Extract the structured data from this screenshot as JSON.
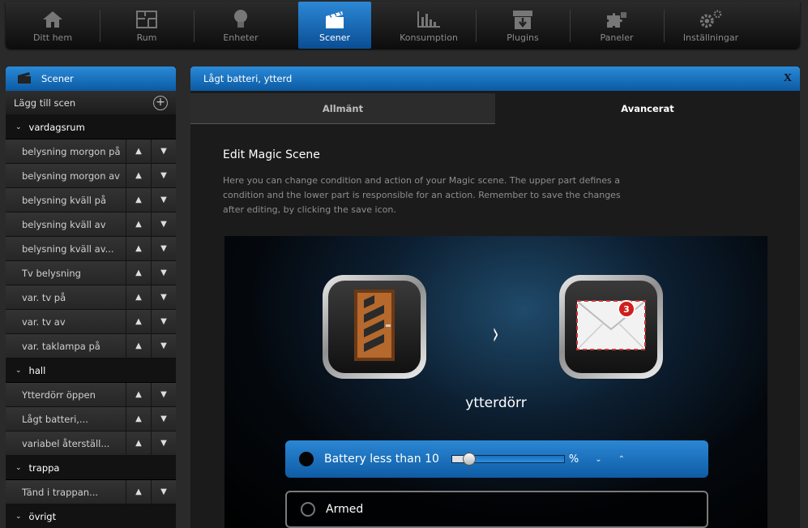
{
  "nav": {
    "items": [
      {
        "label": "Ditt hem",
        "icon": "house-icon"
      },
      {
        "label": "Rum",
        "icon": "floorplan-icon"
      },
      {
        "label": "Enheter",
        "icon": "lightbulb-icon"
      },
      {
        "label": "Scener",
        "icon": "clapperboard-icon",
        "active": true
      },
      {
        "label": "Konsumption",
        "icon": "bar-chart-icon"
      },
      {
        "label": "Plugins",
        "icon": "download-box-icon"
      },
      {
        "label": "Paneler",
        "icon": "puzzle-icon"
      },
      {
        "label": "Inställningar",
        "icon": "gears-icon"
      }
    ]
  },
  "sidebar": {
    "title": "Scener",
    "add_label": "Lägg till scen",
    "add_glyph": "+",
    "groups": [
      {
        "name": "vardagsrum",
        "scenes": [
          "belysning morgon på",
          "belysning morgon av",
          "belysning kväll på",
          "belysning kväll av",
          "belysning kväll av...",
          "Tv belysning",
          "var. tv på",
          "var. tv av",
          "var. taklampa på"
        ]
      },
      {
        "name": "hall",
        "scenes": [
          "Ytterdörr öppen",
          "Lågt batteri,...",
          "variabel återställ..."
        ]
      },
      {
        "name": "trappa",
        "scenes": [
          "Tänd i trappan..."
        ]
      },
      {
        "name": "övrigt",
        "scenes": []
      }
    ]
  },
  "panel": {
    "title": "Lågt batteri, ytterd",
    "close_label": "X",
    "tabs": [
      "Allmänt",
      "Avancerat"
    ],
    "active_tab": "Avancerat",
    "heading": "Edit Magic Scene",
    "description": "Here you can change condition and action of your Magic scene. The upper part defines a condition and the lower part is responsible for an action. Remember to save the changes after editing, by clicking the save icon.",
    "stage": {
      "device_name": "ytterdörr",
      "trigger_icon": "door-icon",
      "action_icon": "mail-icon",
      "action_badge": "3",
      "separator_glyph": "›"
    },
    "conditions": [
      {
        "label": "Battery less than 10",
        "unit": "%",
        "slider_fraction": 0.15,
        "down_glyph": "⌄",
        "up_glyph": "⌃"
      },
      {
        "label": "Armed"
      }
    ]
  },
  "colors": {
    "accent_blue": "#1a74c4",
    "sidebar_bg": "#1e1e1e",
    "badge_red": "#d01d1d"
  }
}
